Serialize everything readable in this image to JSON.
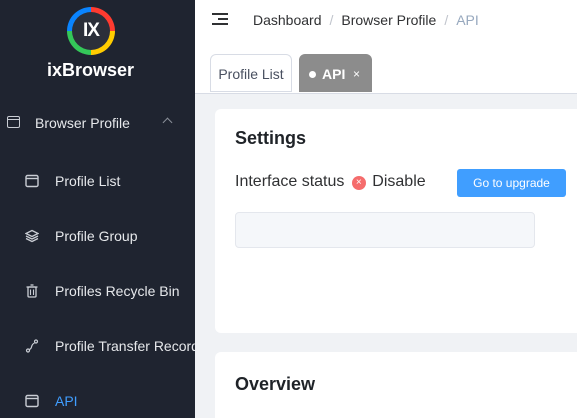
{
  "sidebar": {
    "logo_text": "IX",
    "app_name": "ixBrowser",
    "parent": {
      "label": "Browser Profile",
      "icon": "browser-window-icon"
    },
    "items": [
      {
        "label": "Profile List",
        "icon": "browser-window-icon"
      },
      {
        "label": "Profile Group",
        "icon": "layers-icon"
      },
      {
        "label": "Profiles Recycle Bin",
        "icon": "trash-icon"
      },
      {
        "label": "Profile Transfer Record",
        "icon": "transfer-icon"
      },
      {
        "label": "API",
        "icon": "browser-window-icon",
        "active": true
      }
    ]
  },
  "header": {
    "breadcrumb": [
      "Dashboard",
      "Browser Profile",
      "API"
    ],
    "separator": "/"
  },
  "tabs": [
    {
      "label": "Profile List",
      "active": false
    },
    {
      "label": "API",
      "active": true,
      "close": "×"
    }
  ],
  "settings": {
    "title": "Settings",
    "status_label": "Interface status",
    "status_value": "Disable",
    "status_icon": "×",
    "upgrade_button": "Go to upgrade"
  },
  "overview": {
    "title": "Overview"
  },
  "colors": {
    "sidebar_bg": "#1f2430",
    "accent": "#409eff",
    "active_tab": "#8c8c8c",
    "error": "#f56c6c"
  }
}
